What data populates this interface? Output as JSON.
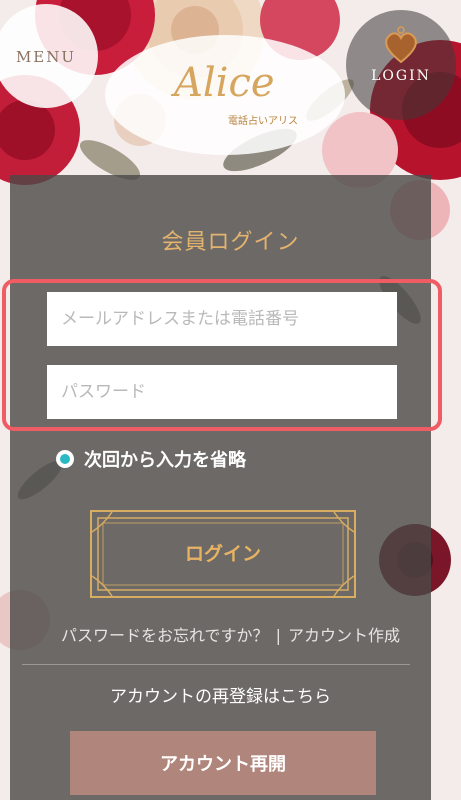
{
  "header": {
    "menu_label": "MENU",
    "login_label": "LOGIN",
    "logo_text": "Alice",
    "logo_subtitle": "電話占いアリス"
  },
  "login_form": {
    "title": "会員ログイン",
    "email_placeholder": "メールアドレスまたは電話番号",
    "password_placeholder": "パスワード",
    "remember_label": "次回から入力を省略",
    "login_button": "ログイン",
    "forgot_password_link": "パスワードをお忘れですか？",
    "separator": "|",
    "create_account_link": "アカウント作成",
    "re_register_text": "アカウントの再登録はこちら",
    "reopen_button": "アカウント再開"
  },
  "colors": {
    "accent_gold": "#e4b36d",
    "highlight_red": "#ef5c63",
    "radio_teal": "#2bb9c3",
    "reopen_button": "#b0857b"
  },
  "icons": [
    "heart-locket-icon",
    "radio-selected-icon"
  ]
}
